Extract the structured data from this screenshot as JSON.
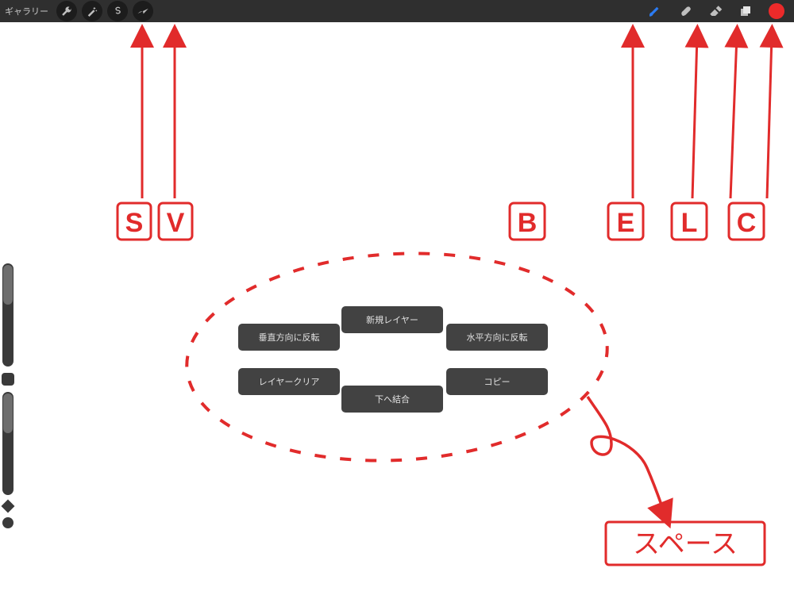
{
  "topbar": {
    "gallery_label": "ギャラリー"
  },
  "quickmenu": {
    "top": "新規レイヤー",
    "left_upper": "垂直方向に反転",
    "right_upper": "水平方向に反転",
    "left_lower": "レイヤークリア",
    "right_lower": "コピー",
    "bottom": "下へ結合"
  },
  "annotations": {
    "s": "S",
    "v": "V",
    "b": "B",
    "e": "E",
    "l": "L",
    "c": "C",
    "space_label": "スペース"
  },
  "colors": {
    "accent_red": "#d62a2a",
    "arrow_red": "#e12b2b"
  }
}
